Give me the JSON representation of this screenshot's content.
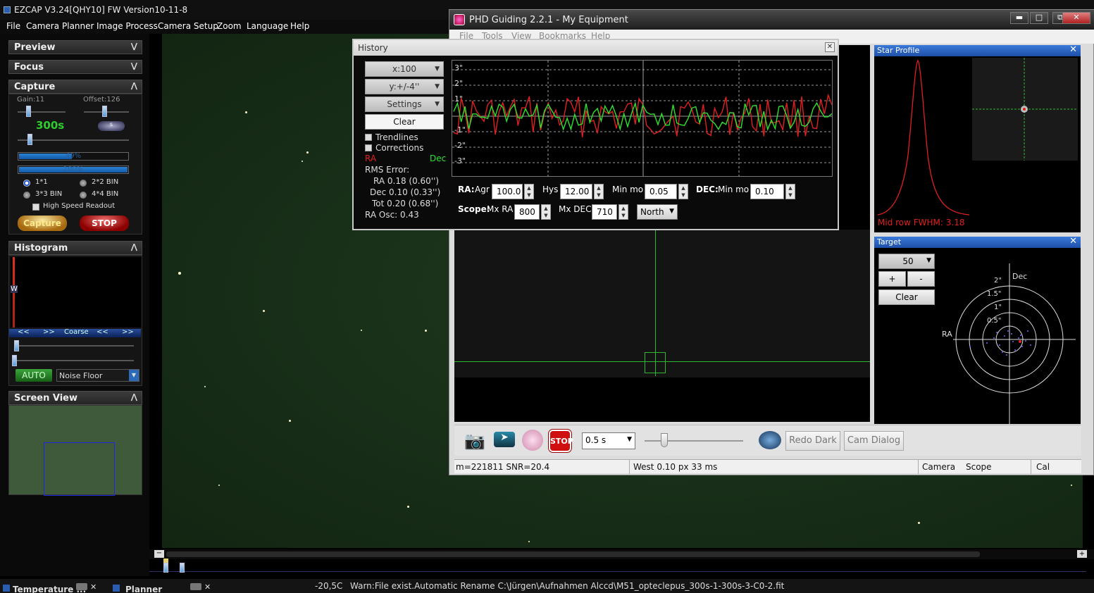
{
  "ezcap": {
    "title": "EZCAP V3.24[QHY10] FW Version10-11-8",
    "menu": [
      "File",
      "Camera",
      "Planner",
      "Image Process",
      "Camera Setup",
      "Zoom",
      "Language",
      "Help"
    ],
    "panels": {
      "preview": "Preview",
      "focus": "Focus",
      "capture": "Capture",
      "histogram": "Histogram",
      "screen_view": "Screen View"
    },
    "capture": {
      "gain_label": "Gain:11",
      "offset_label": "Offset:126",
      "exposure": "300s",
      "unit_button": "s",
      "progress1_label": "49%",
      "progress1_value": 0.49,
      "progress2_label": "100%",
      "progress2_value": 1.0,
      "bin1": "1*1",
      "bin2": "2*2 BIN",
      "bin3": "3*3 BIN",
      "bin4": "4*4 BIN",
      "high_speed": "High Speed Readout",
      "capture_button": "Capture",
      "stop_button": "STOP"
    },
    "histogram": {
      "marker": "W",
      "left1": "<<",
      "right1": ">>",
      "coarse": "Coarse",
      "left2": "<<",
      "right2": ">>",
      "auto_button": "AUTO",
      "mode_value": "Noise Floor"
    },
    "status": {
      "temperature_tab": "Temperature ...",
      "planner_tab": "Planner",
      "temperature": "-20,5C",
      "message": "Warn:File exist.Automatic Rename C:\\Jürgen\\Aufnahmen Alccd\\M51_opteclepus_300s-1-300s-3-C0-2.fit"
    }
  },
  "phd": {
    "title": "PHD Guiding 2.2.1 - My Equipment",
    "menu": [
      "File",
      "Tools",
      "View",
      "Bookmarks",
      "Help"
    ],
    "toolbar": {
      "exposure_value": "0.5 s",
      "redo_dark": "Redo Dark",
      "cam_dialog": "Cam Dialog"
    },
    "status": {
      "stats": "m=221811 SNR=20.4",
      "guide": "West  0.10 px  33 ms",
      "camera": "Camera",
      "scope": "Scope",
      "cal": "Cal"
    },
    "star_profile": {
      "title": "Star Profile",
      "fwhm": "Mid row FWHM: 3.18"
    },
    "target": {
      "title": "Target",
      "scale_value": "50",
      "plus": "+",
      "minus": "-",
      "clear": "Clear",
      "ring_labels": [
        "2\"",
        "1.5\"",
        "1\"",
        "0.5\""
      ],
      "ra_label": "RA",
      "dec_label": "Dec"
    }
  },
  "history": {
    "title": "History",
    "x_scale": "x:100",
    "y_scale": "y:+/-4''",
    "settings": "Settings",
    "clear": "Clear",
    "trendlines": "Trendlines",
    "corrections": "Corrections",
    "ra_legend": "RA",
    "dec_legend": "Dec",
    "rms_title": "RMS Error:",
    "rms_ra": "RA 0.18 (0.60'')",
    "rms_dec": "Dec 0.10 (0.33'')",
    "rms_tot": "Tot 0.20 (0.68'')",
    "ra_osc": "RA Osc: 0.43",
    "y_labels": [
      "3\"",
      "2\"",
      "1\"",
      "-1\"",
      "-2\"",
      "-3\""
    ],
    "params": {
      "ra_label": "RA:",
      "agr_label": "Agr",
      "agr_value": "100.0",
      "hys_label": "Hys",
      "hys_value": "12.00",
      "minmo_label": "Min mo",
      "minmo_value": "0.05",
      "dec_label": "DEC:",
      "dec_minmo_label": "Min mo",
      "dec_minmo_value": "0.10",
      "scope_label": "Scope:",
      "mxra_label": "Mx RA",
      "mxra_value": "800",
      "mxdec_label": "Mx DEC",
      "mxdec_value": "710",
      "direction_value": "North"
    },
    "colors": {
      "ra": "#e02020",
      "dec": "#30e030"
    }
  }
}
